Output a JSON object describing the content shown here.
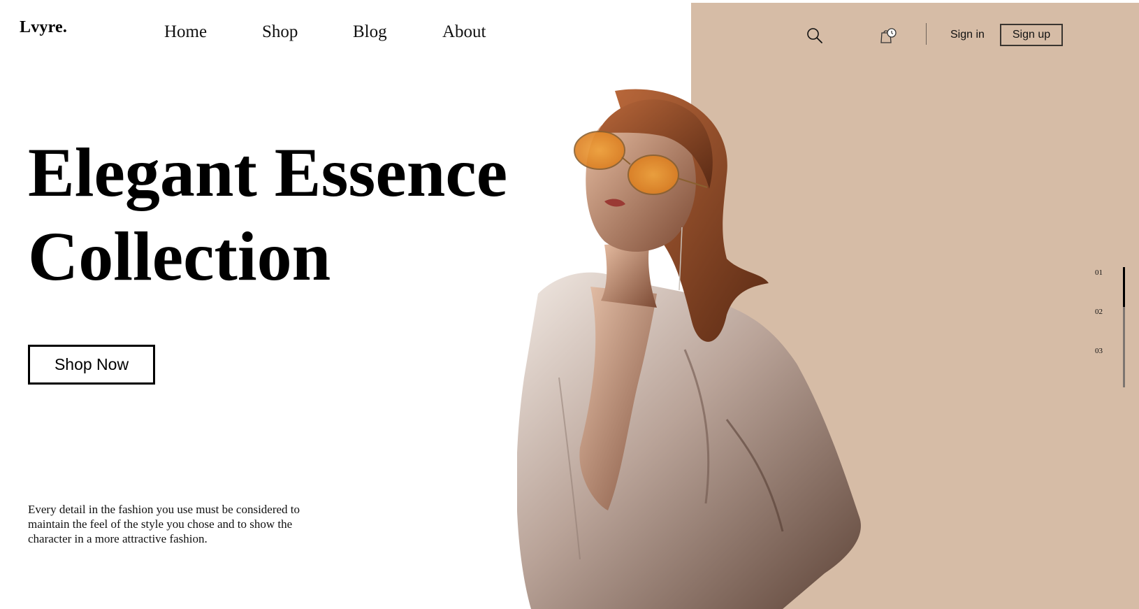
{
  "brand": {
    "logo": "Lvyre."
  },
  "nav": {
    "items": [
      {
        "label": "Home"
      },
      {
        "label": "Shop"
      },
      {
        "label": "Blog"
      },
      {
        "label": "About"
      }
    ]
  },
  "header": {
    "search_icon": "search-icon",
    "bag_icon": "shopping-bag-clock-icon",
    "sign_in": "Sign in",
    "sign_up": "Sign up"
  },
  "hero": {
    "title_line1": "Elegant Essence",
    "title_line2": "Collection",
    "cta": "Shop Now",
    "description": "Every detail in the fashion you use must be considered to maintain the feel of the style you chose and to show the character in a more attractive fashion."
  },
  "slider": {
    "slides": [
      "01",
      "02",
      "03"
    ],
    "active_index": 0
  },
  "colors": {
    "panel": "#d6bca6",
    "text": "#000000",
    "background": "#ffffff"
  }
}
